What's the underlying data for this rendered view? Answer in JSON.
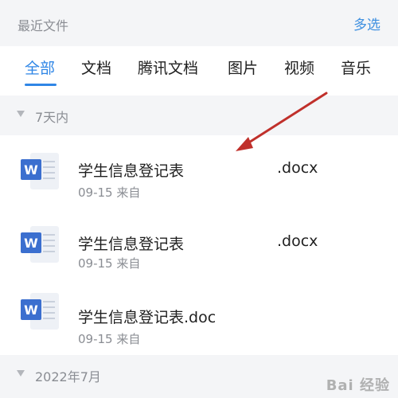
{
  "header": {
    "title": "最近文件",
    "multi_select": "多选"
  },
  "tabs": [
    {
      "label": "全部",
      "active": true
    },
    {
      "label": "文档"
    },
    {
      "label": "腾讯文档"
    },
    {
      "label": "图片"
    },
    {
      "label": "视频"
    },
    {
      "label": "音乐"
    }
  ],
  "sections": [
    {
      "label": "7天内"
    },
    {
      "label": "2022年7月"
    }
  ],
  "files": [
    {
      "name": "学生信息登记表",
      "ext": ".docx",
      "meta": "09-15 来自",
      "icon": "word-doc-icon"
    },
    {
      "name": "学生信息登记表",
      "ext": ".docx",
      "meta": "09-15 来自",
      "icon": "word-doc-icon"
    },
    {
      "name": "学生信息登记表.doc",
      "ext": "",
      "meta": "09-15 来自",
      "icon": "word-doc-icon"
    }
  ],
  "watermark": "Bai 经验",
  "colors": {
    "accent": "#2f86e6",
    "word_blue": "#3b6fcf",
    "annotation_arrow": "#c0302b"
  }
}
